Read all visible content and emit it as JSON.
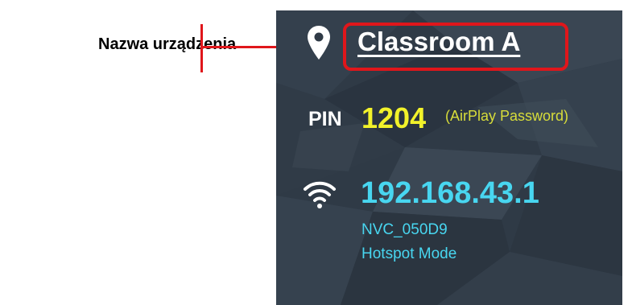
{
  "callout": {
    "label": "Nazwa urządzenia",
    "color": "#e0161b"
  },
  "panel": {
    "background": "#2f3a46",
    "device": {
      "icon": "location-pin-icon",
      "name": "Classroom A"
    },
    "pin": {
      "label": "PIN",
      "value": "1204",
      "hint": "(AirPlay Password)",
      "value_color": "#f2f22a"
    },
    "network": {
      "icon": "wifi-icon",
      "ip": "192.168.43.1",
      "ssid": "NVC_050D9",
      "mode": "Hotspot Mode",
      "text_color": "#48d6f0"
    }
  }
}
